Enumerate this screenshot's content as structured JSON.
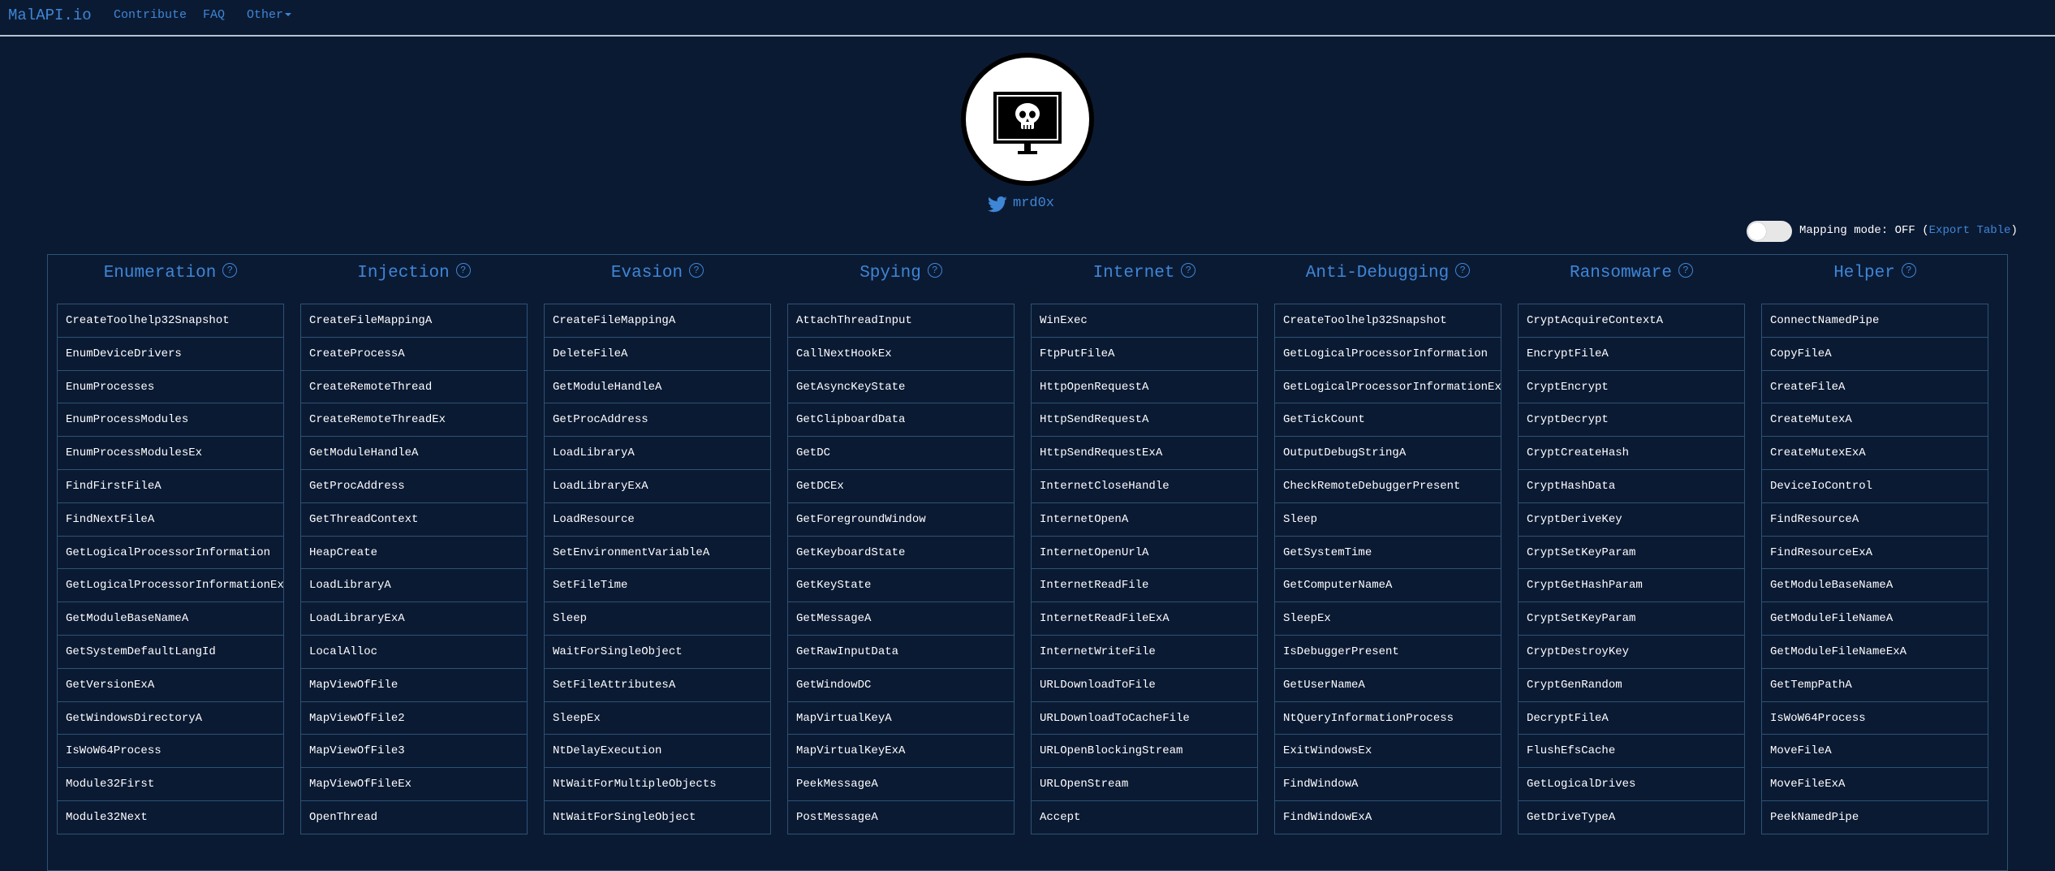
{
  "nav": {
    "brand": "MalAPI.io",
    "links": [
      "Contribute",
      "FAQ"
    ],
    "other": "Other"
  },
  "profile": {
    "handle": "mrd0x"
  },
  "mapping": {
    "label": "Mapping mode: OFF (",
    "export": "Export Table",
    "close": ")"
  },
  "categories": [
    {
      "title": "Enumeration",
      "items": [
        "CreateToolhelp32Snapshot",
        "EnumDeviceDrivers",
        "EnumProcesses",
        "EnumProcessModules",
        "EnumProcessModulesEx",
        "FindFirstFileA",
        "FindNextFileA",
        "GetLogicalProcessorInformation",
        "GetLogicalProcessorInformationEx",
        "GetModuleBaseNameA",
        "GetSystemDefaultLangId",
        "GetVersionExA",
        "GetWindowsDirectoryA",
        "IsWoW64Process",
        "Module32First",
        "Module32Next"
      ]
    },
    {
      "title": "Injection",
      "items": [
        "CreateFileMappingA",
        "CreateProcessA",
        "CreateRemoteThread",
        "CreateRemoteThreadEx",
        "GetModuleHandleA",
        "GetProcAddress",
        "GetThreadContext",
        "HeapCreate",
        "LoadLibraryA",
        "LoadLibraryExA",
        "LocalAlloc",
        "MapViewOfFile",
        "MapViewOfFile2",
        "MapViewOfFile3",
        "MapViewOfFileEx",
        "OpenThread"
      ]
    },
    {
      "title": "Evasion",
      "items": [
        "CreateFileMappingA",
        "DeleteFileA",
        "GetModuleHandleA",
        "GetProcAddress",
        "LoadLibraryA",
        "LoadLibraryExA",
        "LoadResource",
        "SetEnvironmentVariableA",
        "SetFileTime",
        "Sleep",
        "WaitForSingleObject",
        "SetFileAttributesA",
        "SleepEx",
        "NtDelayExecution",
        "NtWaitForMultipleObjects",
        "NtWaitForSingleObject"
      ]
    },
    {
      "title": "Spying",
      "items": [
        "AttachThreadInput",
        "CallNextHookEx",
        "GetAsyncKeyState",
        "GetClipboardData",
        "GetDC",
        "GetDCEx",
        "GetForegroundWindow",
        "GetKeyboardState",
        "GetKeyState",
        "GetMessageA",
        "GetRawInputData",
        "GetWindowDC",
        "MapVirtualKeyA",
        "MapVirtualKeyExA",
        "PeekMessageA",
        "PostMessageA"
      ]
    },
    {
      "title": "Internet",
      "items": [
        "WinExec",
        "FtpPutFileA",
        "HttpOpenRequestA",
        "HttpSendRequestA",
        "HttpSendRequestExA",
        "InternetCloseHandle",
        "InternetOpenA",
        "InternetOpenUrlA",
        "InternetReadFile",
        "InternetReadFileExA",
        "InternetWriteFile",
        "URLDownloadToFile",
        "URLDownloadToCacheFile",
        "URLOpenBlockingStream",
        "URLOpenStream",
        "Accept"
      ]
    },
    {
      "title": "Anti-Debugging",
      "items": [
        "CreateToolhelp32Snapshot",
        "GetLogicalProcessorInformation",
        "GetLogicalProcessorInformationEx",
        "GetTickCount",
        "OutputDebugStringA",
        "CheckRemoteDebuggerPresent",
        "Sleep",
        "GetSystemTime",
        "GetComputerNameA",
        "SleepEx",
        "IsDebuggerPresent",
        "GetUserNameA",
        "NtQueryInformationProcess",
        "ExitWindowsEx",
        "FindWindowA",
        "FindWindowExA"
      ]
    },
    {
      "title": "Ransomware",
      "items": [
        "CryptAcquireContextA",
        "EncryptFileA",
        "CryptEncrypt",
        "CryptDecrypt",
        "CryptCreateHash",
        "CryptHashData",
        "CryptDeriveKey",
        "CryptSetKeyParam",
        "CryptGetHashParam",
        "CryptSetKeyParam",
        "CryptDestroyKey",
        "CryptGenRandom",
        "DecryptFileA",
        "FlushEfsCache",
        "GetLogicalDrives",
        "GetDriveTypeA"
      ]
    },
    {
      "title": "Helper",
      "items": [
        "ConnectNamedPipe",
        "CopyFileA",
        "CreateFileA",
        "CreateMutexA",
        "CreateMutexExA",
        "DeviceIoControl",
        "FindResourceA",
        "FindResourceExA",
        "GetModuleBaseNameA",
        "GetModuleFileNameA",
        "GetModuleFileNameExA",
        "GetTempPathA",
        "IsWoW64Process",
        "MoveFileA",
        "MoveFileExA",
        "PeekNamedPipe"
      ]
    }
  ],
  "help_glyph": "?",
  "colors": {
    "background": "#0b1a33",
    "accent": "#3e86d6",
    "border": "#2b5375"
  }
}
